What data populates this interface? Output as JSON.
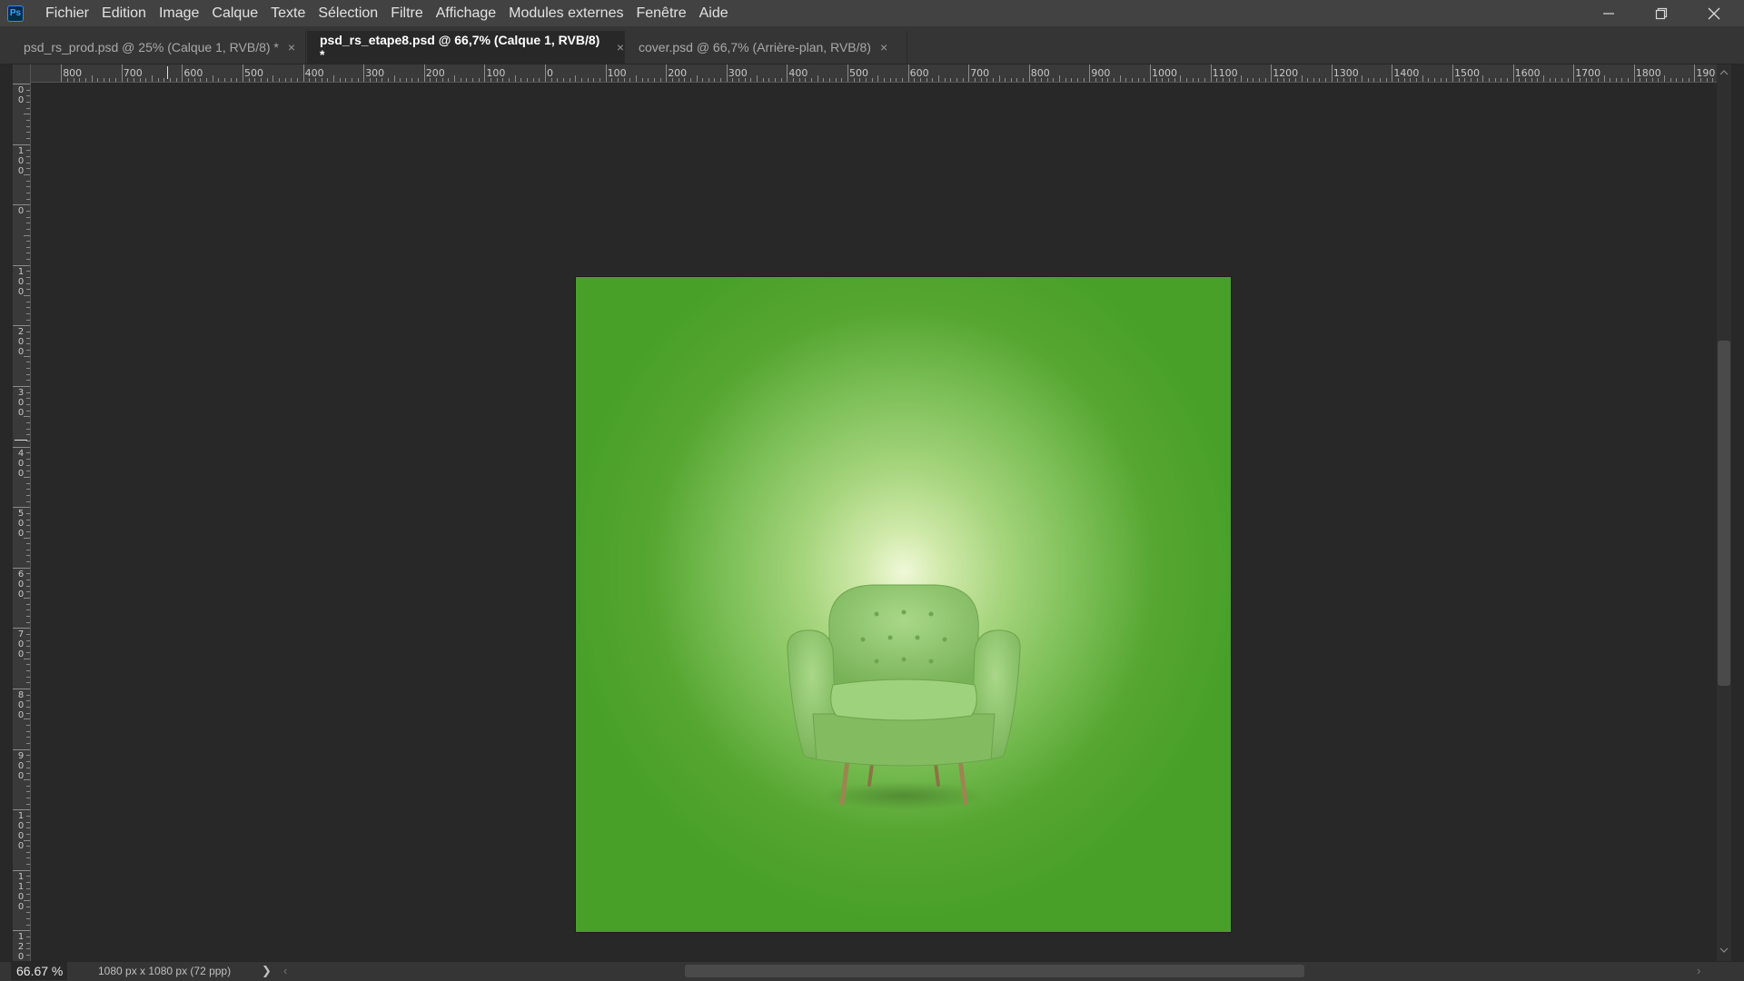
{
  "app": {
    "logo_text": "Ps"
  },
  "menu": [
    "Fichier",
    "Edition",
    "Image",
    "Calque",
    "Texte",
    "Sélection",
    "Filtre",
    "Affichage",
    "Modules externes",
    "Fenêtre",
    "Aide"
  ],
  "tabs": [
    {
      "label": "psd_rs_prod.psd @ 25% (Calque 1, RVB/8) *",
      "active": false
    },
    {
      "label": "psd_rs_etape8.psd @ 66,7% (Calque 1, RVB/8) *",
      "active": true
    },
    {
      "label": "cover.psd @ 66,7% (Arrière-plan, RVB/8)",
      "active": false
    }
  ],
  "tab_close_glyph": "×",
  "ruler_top_labels": [
    "800",
    "700",
    "600",
    "500",
    "400",
    "300",
    "200",
    "100",
    "0",
    "100",
    "200",
    "300",
    "400",
    "500",
    "600",
    "700",
    "800",
    "900",
    "1000",
    "1100",
    "1200",
    "1300",
    "1400",
    "1500",
    "1600",
    "1700",
    "1800",
    "190"
  ],
  "ruler_left_labels": [
    "0\n0",
    "1\n0\n0",
    "0",
    "1\n0\n0",
    "2\n0\n0",
    "3\n0\n0",
    "4\n0\n0",
    "5\n0\n0",
    "6\n0\n0",
    "7\n0\n0",
    "8\n0\n0",
    "9\n0\n0",
    "1\n0\n0\n0",
    "1\n1\n0\n0",
    "1\n2\n0"
  ],
  "status": {
    "zoom": "66.67 %",
    "doc_info": "1080 px x 1080 px (72 ppp)",
    "arrow": "❯",
    "scroll_left": "‹",
    "scroll_right": "›"
  },
  "colors": {
    "accent": "#31a8ff",
    "canvas_green": "#48a028",
    "workspace": "#282828"
  },
  "icons": {
    "minimize": "minimize-icon",
    "restore": "restore-icon",
    "close": "close-icon"
  }
}
